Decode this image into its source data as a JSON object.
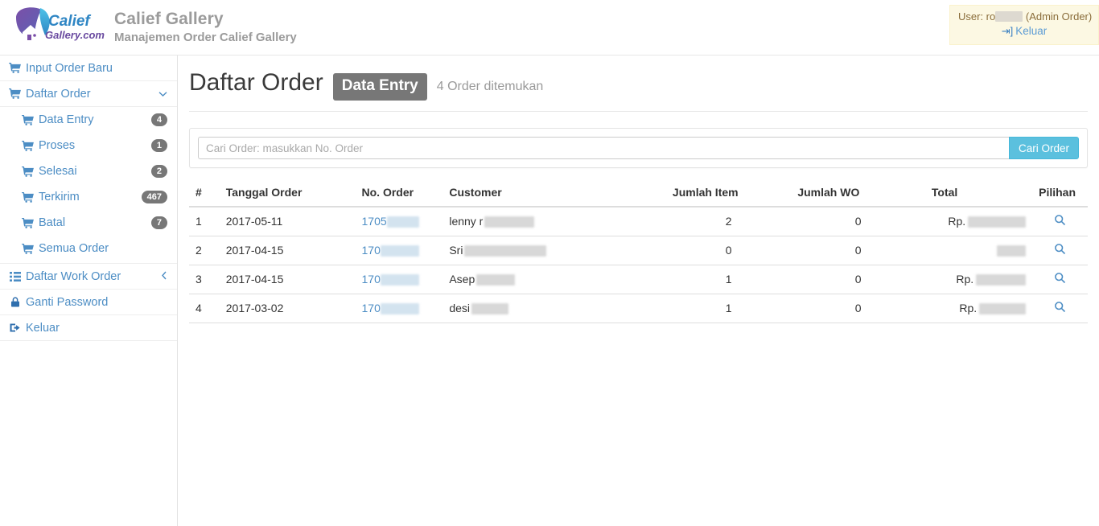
{
  "header": {
    "logo_alt": "Calief Gallery logo",
    "logo_word_1": "Calief",
    "logo_word_2": "Gallery.com",
    "brand_title": "Calief Gallery",
    "brand_subtitle": "Manajemen Order Calief Gallery",
    "user": {
      "prefix": "User: ro",
      "redacted": true,
      "role": "(Admin Order)",
      "logout_label": "Keluar",
      "logout_icon": "sign-out-icon"
    }
  },
  "sidebar": {
    "items": [
      {
        "label": "Input Order Baru",
        "icon": "cart-icon",
        "level": 0,
        "badge": null,
        "chevron": null
      },
      {
        "label": "Daftar Order",
        "icon": "cart-icon",
        "level": 0,
        "badge": null,
        "chevron": "chevron-down-icon"
      },
      {
        "label": "Data Entry",
        "icon": "cart-icon",
        "level": 1,
        "badge": "4",
        "chevron": null
      },
      {
        "label": "Proses",
        "icon": "cart-icon",
        "level": 1,
        "badge": "1",
        "chevron": null
      },
      {
        "label": "Selesai",
        "icon": "cart-icon",
        "level": 1,
        "badge": "2",
        "chevron": null
      },
      {
        "label": "Terkirim",
        "icon": "cart-icon",
        "level": 1,
        "badge": "467",
        "chevron": null
      },
      {
        "label": "Batal",
        "icon": "cart-icon",
        "level": 1,
        "badge": "7",
        "chevron": null
      },
      {
        "label": "Semua Order",
        "icon": "cart-icon",
        "level": 1,
        "badge": null,
        "chevron": null
      },
      {
        "label": "Daftar Work Order",
        "icon": "list-icon",
        "level": 0,
        "badge": null,
        "chevron": "chevron-left-icon"
      },
      {
        "label": "Ganti Password",
        "icon": "lock-icon",
        "level": 0,
        "badge": null,
        "chevron": null
      },
      {
        "label": "Keluar",
        "icon": "sign-out-icon",
        "level": 0,
        "badge": null,
        "chevron": null
      }
    ]
  },
  "main": {
    "title": "Daftar Order",
    "status_badge": "Data Entry",
    "result_text": "4 Order ditemukan",
    "search": {
      "placeholder": "Cari Order: masukkan No. Order",
      "value": "",
      "button_label": "Cari Order"
    },
    "table": {
      "columns": [
        "#",
        "Tanggal Order",
        "No. Order",
        "Customer",
        "Jumlah Item",
        "Jumlah WO",
        "Total",
        "Pilihan"
      ],
      "action_icon": "magnifier-icon",
      "currency_prefix": "Rp.",
      "rows": [
        {
          "num": "1",
          "date": "2017-05-11",
          "order_no_visible": "1705",
          "order_no_redacted_w": 40,
          "customer_visible": "lenny r",
          "customer_redacted_w": 62,
          "items": "2",
          "wo": "0",
          "total_prefix": "Rp.",
          "total_redacted_w": 72
        },
        {
          "num": "2",
          "date": "2017-04-15",
          "order_no_visible": "170",
          "order_no_redacted_w": 48,
          "customer_visible": "Sri",
          "customer_redacted_w": 102,
          "items": "0",
          "wo": "0",
          "total_prefix": "",
          "total_redacted_w": 36
        },
        {
          "num": "3",
          "date": "2017-04-15",
          "order_no_visible": "170",
          "order_no_redacted_w": 48,
          "customer_visible": "Asep",
          "customer_redacted_w": 48,
          "items": "1",
          "wo": "0",
          "total_prefix": "Rp.",
          "total_redacted_w": 62
        },
        {
          "num": "4",
          "date": "2017-03-02",
          "order_no_visible": "170",
          "order_no_redacted_w": 48,
          "customer_visible": "desi",
          "customer_redacted_w": 46,
          "items": "1",
          "wo": "0",
          "total_prefix": "Rp.",
          "total_redacted_w": 58
        }
      ]
    }
  },
  "colors": {
    "link": "#4c8dc4",
    "badge": "#777777",
    "search_button": "#5bc0de",
    "user_box_bg": "#fcf8e3",
    "brand_text": "#9b9b9b"
  }
}
